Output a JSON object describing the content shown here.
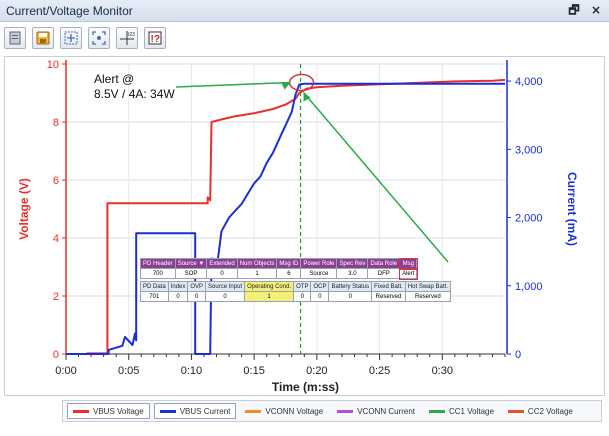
{
  "window": {
    "title": "Current/Voltage Monitor",
    "pin_glyph": "🗗",
    "close_glyph": "×"
  },
  "toolbar": {
    "buttons": [
      {
        "name": "clear-icon"
      },
      {
        "name": "save-icon"
      },
      {
        "name": "zoom-fit-icon"
      },
      {
        "name": "zoom-icon"
      },
      {
        "name": "cursor-icon",
        "label": "t23"
      },
      {
        "name": "help-icon",
        "label": "!?"
      }
    ]
  },
  "chart_data": {
    "type": "line",
    "title": "",
    "xlabel": "Time (m:ss)",
    "ylabel_left": "Voltage (V)",
    "ylabel_right": "Current (mA)",
    "x_ticks": [
      "0:00",
      "0:05",
      "0:10",
      "0:15",
      "0:20",
      "0:25",
      "0:30"
    ],
    "x_tick_seconds": [
      0,
      5,
      10,
      15,
      20,
      25,
      30
    ],
    "xlim": [
      0,
      35
    ],
    "ylim_left": [
      0,
      10
    ],
    "y_ticks_left": [
      "0",
      "2",
      "4",
      "6",
      "8",
      "10"
    ],
    "y_tick_values_left": [
      0,
      2,
      4,
      6,
      8,
      10
    ],
    "ylim_right": [
      0,
      4250
    ],
    "y_ticks_right": [
      "0",
      "1,000",
      "2,000",
      "3,000",
      "4,000"
    ],
    "y_tick_values_right": [
      0,
      1000,
      2000,
      3000,
      4000
    ],
    "colors": {
      "voltage": "#e8302a",
      "current": "#1a2fd6",
      "annotation": "#2aa84a",
      "marker": "#1a9b3a",
      "circle": "#d0344a"
    },
    "series": [
      {
        "name": "VBUS Voltage",
        "axis": "left",
        "points": [
          [
            0,
            0
          ],
          [
            1.7,
            0
          ],
          [
            1.7,
            0.02
          ],
          [
            3.3,
            0.02
          ],
          [
            3.3,
            5.2
          ],
          [
            11.3,
            5.2
          ],
          [
            11.3,
            5.4
          ],
          [
            11.5,
            5.3
          ],
          [
            11.6,
            8.0
          ],
          [
            12.5,
            8.1
          ],
          [
            13.5,
            8.2
          ],
          [
            15,
            8.3
          ],
          [
            16.5,
            8.45
          ],
          [
            17.5,
            8.6
          ],
          [
            18.3,
            8.8
          ],
          [
            18.6,
            9.0
          ],
          [
            19.2,
            9.15
          ],
          [
            20,
            9.2
          ],
          [
            22,
            9.25
          ],
          [
            25,
            9.3
          ],
          [
            28,
            9.35
          ],
          [
            31,
            9.4
          ],
          [
            34,
            9.42
          ],
          [
            35,
            9.45
          ]
        ]
      },
      {
        "name": "VBUS Current",
        "axis": "right",
        "points": [
          [
            0,
            0
          ],
          [
            3.4,
            0
          ],
          [
            3.4,
            60
          ],
          [
            4.5,
            120
          ],
          [
            4.7,
            250
          ],
          [
            5.3,
            130
          ],
          [
            5.5,
            300
          ],
          [
            5.6,
            200
          ],
          [
            5.6,
            1770
          ],
          [
            10.3,
            1770
          ],
          [
            10.3,
            0
          ],
          [
            11.5,
            0
          ],
          [
            11.6,
            1400
          ],
          [
            12.1,
            1380
          ],
          [
            12.4,
            1800
          ],
          [
            13,
            2000
          ],
          [
            13.5,
            2100
          ],
          [
            14,
            2200
          ],
          [
            14.5,
            2350
          ],
          [
            15,
            2500
          ],
          [
            15.5,
            2600
          ],
          [
            16,
            2800
          ],
          [
            16.5,
            2950
          ],
          [
            17,
            3150
          ],
          [
            17.5,
            3350
          ],
          [
            18,
            3550
          ],
          [
            18.3,
            3800
          ],
          [
            18.6,
            3950
          ],
          [
            19,
            3960
          ],
          [
            35,
            3960
          ]
        ]
      }
    ],
    "marker_x": 18.7,
    "annotation": {
      "text_line1": "Alert @",
      "text_line2": "8.5V / 4A:  34W"
    },
    "legend": [
      {
        "name": "VBUS Voltage",
        "color": "#e8302a",
        "active": true
      },
      {
        "name": "VBUS Current",
        "color": "#1a2fd6",
        "active": true
      },
      {
        "name": "VCONN Voltage",
        "color": "#f28a2e",
        "active": false
      },
      {
        "name": "VCONN Current",
        "color": "#b052d8",
        "active": false
      },
      {
        "name": "CC1 Voltage",
        "color": "#2aa84a",
        "active": false
      },
      {
        "name": "CC2 Voltage",
        "color": "#e0552d",
        "active": false
      }
    ]
  },
  "pd_header_table": {
    "headers": [
      "PD Header",
      "Source ▼",
      "Extended",
      "Num Objects",
      "Msg ID",
      "Power Role",
      "Spec Rev",
      "Data Role",
      "Msg"
    ],
    "values": [
      "700",
      "SOP",
      "0",
      "1",
      "6",
      "Source",
      "3.0",
      "DFP",
      "Alert"
    ]
  },
  "pd_data_table": {
    "headers": [
      "PD Data",
      "Index",
      "OVP",
      "Source Input",
      "Operating Cond.",
      "OTP",
      "OCP",
      "Battery Status",
      "Fixed Batt.",
      "Hot Swap Batt."
    ],
    "values": [
      "701",
      "0",
      "0",
      "0",
      "1",
      "0",
      "0",
      "0",
      "Reserved",
      "Reserved"
    ]
  }
}
